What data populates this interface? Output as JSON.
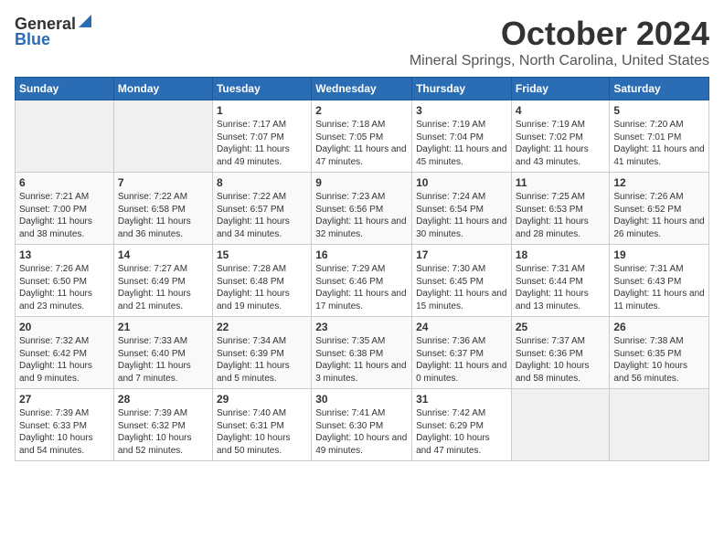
{
  "header": {
    "logo_general": "General",
    "logo_blue": "Blue",
    "month": "October 2024",
    "location": "Mineral Springs, North Carolina, United States"
  },
  "weekdays": [
    "Sunday",
    "Monday",
    "Tuesday",
    "Wednesday",
    "Thursday",
    "Friday",
    "Saturday"
  ],
  "weeks": [
    [
      {
        "day": "",
        "content": ""
      },
      {
        "day": "",
        "content": ""
      },
      {
        "day": "1",
        "content": "Sunrise: 7:17 AM\nSunset: 7:07 PM\nDaylight: 11 hours and 49 minutes."
      },
      {
        "day": "2",
        "content": "Sunrise: 7:18 AM\nSunset: 7:05 PM\nDaylight: 11 hours and 47 minutes."
      },
      {
        "day": "3",
        "content": "Sunrise: 7:19 AM\nSunset: 7:04 PM\nDaylight: 11 hours and 45 minutes."
      },
      {
        "day": "4",
        "content": "Sunrise: 7:19 AM\nSunset: 7:02 PM\nDaylight: 11 hours and 43 minutes."
      },
      {
        "day": "5",
        "content": "Sunrise: 7:20 AM\nSunset: 7:01 PM\nDaylight: 11 hours and 41 minutes."
      }
    ],
    [
      {
        "day": "6",
        "content": "Sunrise: 7:21 AM\nSunset: 7:00 PM\nDaylight: 11 hours and 38 minutes."
      },
      {
        "day": "7",
        "content": "Sunrise: 7:22 AM\nSunset: 6:58 PM\nDaylight: 11 hours and 36 minutes."
      },
      {
        "day": "8",
        "content": "Sunrise: 7:22 AM\nSunset: 6:57 PM\nDaylight: 11 hours and 34 minutes."
      },
      {
        "day": "9",
        "content": "Sunrise: 7:23 AM\nSunset: 6:56 PM\nDaylight: 11 hours and 32 minutes."
      },
      {
        "day": "10",
        "content": "Sunrise: 7:24 AM\nSunset: 6:54 PM\nDaylight: 11 hours and 30 minutes."
      },
      {
        "day": "11",
        "content": "Sunrise: 7:25 AM\nSunset: 6:53 PM\nDaylight: 11 hours and 28 minutes."
      },
      {
        "day": "12",
        "content": "Sunrise: 7:26 AM\nSunset: 6:52 PM\nDaylight: 11 hours and 26 minutes."
      }
    ],
    [
      {
        "day": "13",
        "content": "Sunrise: 7:26 AM\nSunset: 6:50 PM\nDaylight: 11 hours and 23 minutes."
      },
      {
        "day": "14",
        "content": "Sunrise: 7:27 AM\nSunset: 6:49 PM\nDaylight: 11 hours and 21 minutes."
      },
      {
        "day": "15",
        "content": "Sunrise: 7:28 AM\nSunset: 6:48 PM\nDaylight: 11 hours and 19 minutes."
      },
      {
        "day": "16",
        "content": "Sunrise: 7:29 AM\nSunset: 6:46 PM\nDaylight: 11 hours and 17 minutes."
      },
      {
        "day": "17",
        "content": "Sunrise: 7:30 AM\nSunset: 6:45 PM\nDaylight: 11 hours and 15 minutes."
      },
      {
        "day": "18",
        "content": "Sunrise: 7:31 AM\nSunset: 6:44 PM\nDaylight: 11 hours and 13 minutes."
      },
      {
        "day": "19",
        "content": "Sunrise: 7:31 AM\nSunset: 6:43 PM\nDaylight: 11 hours and 11 minutes."
      }
    ],
    [
      {
        "day": "20",
        "content": "Sunrise: 7:32 AM\nSunset: 6:42 PM\nDaylight: 11 hours and 9 minutes."
      },
      {
        "day": "21",
        "content": "Sunrise: 7:33 AM\nSunset: 6:40 PM\nDaylight: 11 hours and 7 minutes."
      },
      {
        "day": "22",
        "content": "Sunrise: 7:34 AM\nSunset: 6:39 PM\nDaylight: 11 hours and 5 minutes."
      },
      {
        "day": "23",
        "content": "Sunrise: 7:35 AM\nSunset: 6:38 PM\nDaylight: 11 hours and 3 minutes."
      },
      {
        "day": "24",
        "content": "Sunrise: 7:36 AM\nSunset: 6:37 PM\nDaylight: 11 hours and 0 minutes."
      },
      {
        "day": "25",
        "content": "Sunrise: 7:37 AM\nSunset: 6:36 PM\nDaylight: 10 hours and 58 minutes."
      },
      {
        "day": "26",
        "content": "Sunrise: 7:38 AM\nSunset: 6:35 PM\nDaylight: 10 hours and 56 minutes."
      }
    ],
    [
      {
        "day": "27",
        "content": "Sunrise: 7:39 AM\nSunset: 6:33 PM\nDaylight: 10 hours and 54 minutes."
      },
      {
        "day": "28",
        "content": "Sunrise: 7:39 AM\nSunset: 6:32 PM\nDaylight: 10 hours and 52 minutes."
      },
      {
        "day": "29",
        "content": "Sunrise: 7:40 AM\nSunset: 6:31 PM\nDaylight: 10 hours and 50 minutes."
      },
      {
        "day": "30",
        "content": "Sunrise: 7:41 AM\nSunset: 6:30 PM\nDaylight: 10 hours and 49 minutes."
      },
      {
        "day": "31",
        "content": "Sunrise: 7:42 AM\nSunset: 6:29 PM\nDaylight: 10 hours and 47 minutes."
      },
      {
        "day": "",
        "content": ""
      },
      {
        "day": "",
        "content": ""
      }
    ]
  ]
}
